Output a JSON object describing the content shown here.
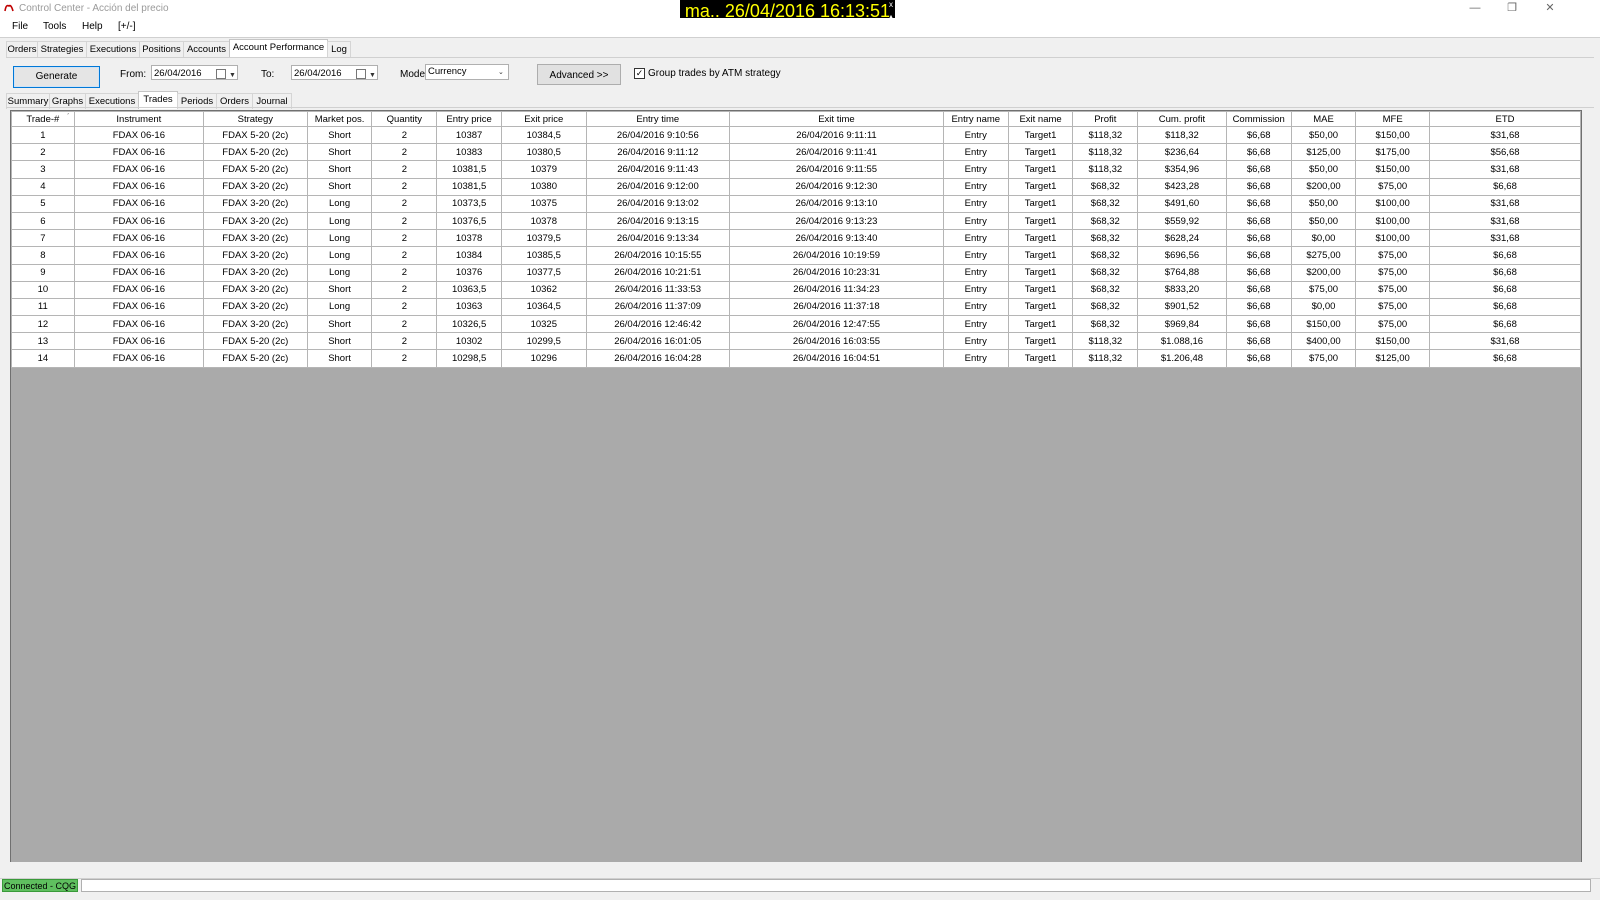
{
  "window": {
    "title": "Control Center - Acción del precio",
    "clock": "ma.. 26/04/2016  16:13:51",
    "minimize": "—",
    "restore": "❐",
    "close": "✕"
  },
  "menu": [
    "File",
    "Tools",
    "Help",
    "[+/-]"
  ],
  "main_tabs": [
    "Orders",
    "Strategies",
    "Executions",
    "Positions",
    "Accounts",
    "Account Performance",
    "Log"
  ],
  "main_tab_active": "Account Performance",
  "toolbar": {
    "generate_label": "Generate",
    "from_label": "From:",
    "from_value": "26/04/2016",
    "to_label": "To:",
    "to_value": "26/04/2016",
    "mode_label": "Mode:",
    "mode_value": "Currency",
    "advanced_label": "Advanced >>",
    "group_label": "Group trades by ATM strategy",
    "group_checked": true
  },
  "sub_tabs": [
    "Summary",
    "Graphs",
    "Executions",
    "Trades",
    "Periods",
    "Orders",
    "Journal"
  ],
  "sub_tab_active": "Trades",
  "table": {
    "columns": [
      "Trade-#",
      "Instrument",
      "Strategy",
      "Market pos.",
      "Quantity",
      "Entry price",
      "Exit price",
      "Entry time",
      "Exit time",
      "Entry name",
      "Exit name",
      "Profit",
      "Cum. profit",
      "Commission",
      "MAE",
      "MFE",
      "ETD"
    ],
    "sort_indicator": "ˊ",
    "rows": [
      [
        "1",
        "FDAX 06-16",
        "FDAX 5-20 (2c)",
        "Short",
        "2",
        "10387",
        "10384,5",
        "26/04/2016 9:10:56",
        "26/04/2016 9:11:11",
        "Entry",
        "Target1",
        "$118,32",
        "$118,32",
        "$6,68",
        "$50,00",
        "$150,00",
        "$31,68"
      ],
      [
        "2",
        "FDAX 06-16",
        "FDAX 5-20 (2c)",
        "Short",
        "2",
        "10383",
        "10380,5",
        "26/04/2016 9:11:12",
        "26/04/2016 9:11:41",
        "Entry",
        "Target1",
        "$118,32",
        "$236,64",
        "$6,68",
        "$125,00",
        "$175,00",
        "$56,68"
      ],
      [
        "3",
        "FDAX 06-16",
        "FDAX 5-20 (2c)",
        "Short",
        "2",
        "10381,5",
        "10379",
        "26/04/2016 9:11:43",
        "26/04/2016 9:11:55",
        "Entry",
        "Target1",
        "$118,32",
        "$354,96",
        "$6,68",
        "$50,00",
        "$150,00",
        "$31,68"
      ],
      [
        "4",
        "FDAX 06-16",
        "FDAX 3-20 (2c)",
        "Short",
        "2",
        "10381,5",
        "10380",
        "26/04/2016 9:12:00",
        "26/04/2016 9:12:30",
        "Entry",
        "Target1",
        "$68,32",
        "$423,28",
        "$6,68",
        "$200,00",
        "$75,00",
        "$6,68"
      ],
      [
        "5",
        "FDAX 06-16",
        "FDAX 3-20 (2c)",
        "Long",
        "2",
        "10373,5",
        "10375",
        "26/04/2016 9:13:02",
        "26/04/2016 9:13:10",
        "Entry",
        "Target1",
        "$68,32",
        "$491,60",
        "$6,68",
        "$50,00",
        "$100,00",
        "$31,68"
      ],
      [
        "6",
        "FDAX 06-16",
        "FDAX 3-20 (2c)",
        "Long",
        "2",
        "10376,5",
        "10378",
        "26/04/2016 9:13:15",
        "26/04/2016 9:13:23",
        "Entry",
        "Target1",
        "$68,32",
        "$559,92",
        "$6,68",
        "$50,00",
        "$100,00",
        "$31,68"
      ],
      [
        "7",
        "FDAX 06-16",
        "FDAX 3-20 (2c)",
        "Long",
        "2",
        "10378",
        "10379,5",
        "26/04/2016 9:13:34",
        "26/04/2016 9:13:40",
        "Entry",
        "Target1",
        "$68,32",
        "$628,24",
        "$6,68",
        "$0,00",
        "$100,00",
        "$31,68"
      ],
      [
        "8",
        "FDAX 06-16",
        "FDAX 3-20 (2c)",
        "Long",
        "2",
        "10384",
        "10385,5",
        "26/04/2016 10:15:55",
        "26/04/2016 10:19:59",
        "Entry",
        "Target1",
        "$68,32",
        "$696,56",
        "$6,68",
        "$275,00",
        "$75,00",
        "$6,68"
      ],
      [
        "9",
        "FDAX 06-16",
        "FDAX 3-20 (2c)",
        "Long",
        "2",
        "10376",
        "10377,5",
        "26/04/2016 10:21:51",
        "26/04/2016 10:23:31",
        "Entry",
        "Target1",
        "$68,32",
        "$764,88",
        "$6,68",
        "$200,00",
        "$75,00",
        "$6,68"
      ],
      [
        "10",
        "FDAX 06-16",
        "FDAX 3-20 (2c)",
        "Short",
        "2",
        "10363,5",
        "10362",
        "26/04/2016 11:33:53",
        "26/04/2016 11:34:23",
        "Entry",
        "Target1",
        "$68,32",
        "$833,20",
        "$6,68",
        "$75,00",
        "$75,00",
        "$6,68"
      ],
      [
        "11",
        "FDAX 06-16",
        "FDAX 3-20 (2c)",
        "Long",
        "2",
        "10363",
        "10364,5",
        "26/04/2016 11:37:09",
        "26/04/2016 11:37:18",
        "Entry",
        "Target1",
        "$68,32",
        "$901,52",
        "$6,68",
        "$0,00",
        "$75,00",
        "$6,68"
      ],
      [
        "12",
        "FDAX 06-16",
        "FDAX 3-20 (2c)",
        "Short",
        "2",
        "10326,5",
        "10325",
        "26/04/2016 12:46:42",
        "26/04/2016 12:47:55",
        "Entry",
        "Target1",
        "$68,32",
        "$969,84",
        "$6,68",
        "$150,00",
        "$75,00",
        "$6,68"
      ],
      [
        "13",
        "FDAX 06-16",
        "FDAX 5-20 (2c)",
        "Short",
        "2",
        "10302",
        "10299,5",
        "26/04/2016 16:01:05",
        "26/04/2016 16:03:55",
        "Entry",
        "Target1",
        "$118,32",
        "$1.088,16",
        "$6,68",
        "$400,00",
        "$150,00",
        "$31,68"
      ],
      [
        "14",
        "FDAX 06-16",
        "FDAX 5-20 (2c)",
        "Short",
        "2",
        "10298,5",
        "10296",
        "26/04/2016 16:04:28",
        "26/04/2016 16:04:51",
        "Entry",
        "Target1",
        "$118,32",
        "$1.206,48",
        "$6,68",
        "$75,00",
        "$125,00",
        "$6,68"
      ]
    ]
  },
  "status": {
    "connection": "Connected - CQG"
  },
  "colors": {
    "clock_bg": "#000000",
    "clock_fg": "#ffff00",
    "grid_empty": "#aaaaaa",
    "connected": "#5fbf5f",
    "generate_border": "#0078d7"
  }
}
